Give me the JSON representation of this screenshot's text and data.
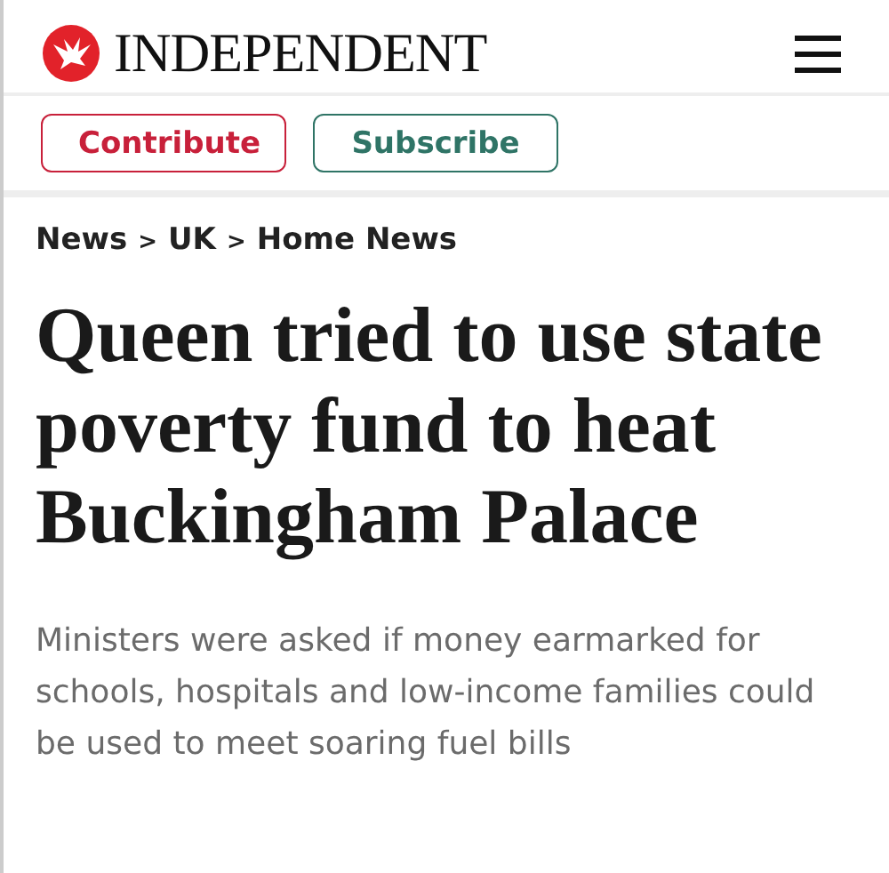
{
  "header": {
    "logo_text": "INDEPENDENT"
  },
  "actions": [
    {
      "label": "Contribute",
      "kind": "contribute"
    },
    {
      "label": "Subscribe",
      "kind": "subscribe"
    }
  ],
  "breadcrumb": [
    "News",
    ">",
    "UK",
    ">",
    "Home News"
  ],
  "headline": "Queen tried to use state poverty fund to heat Buckingham Palace",
  "standfirst": "Ministers were asked if money earmarked for schools, hospitals and low-income families could be used to meet soaring fuel bills"
}
